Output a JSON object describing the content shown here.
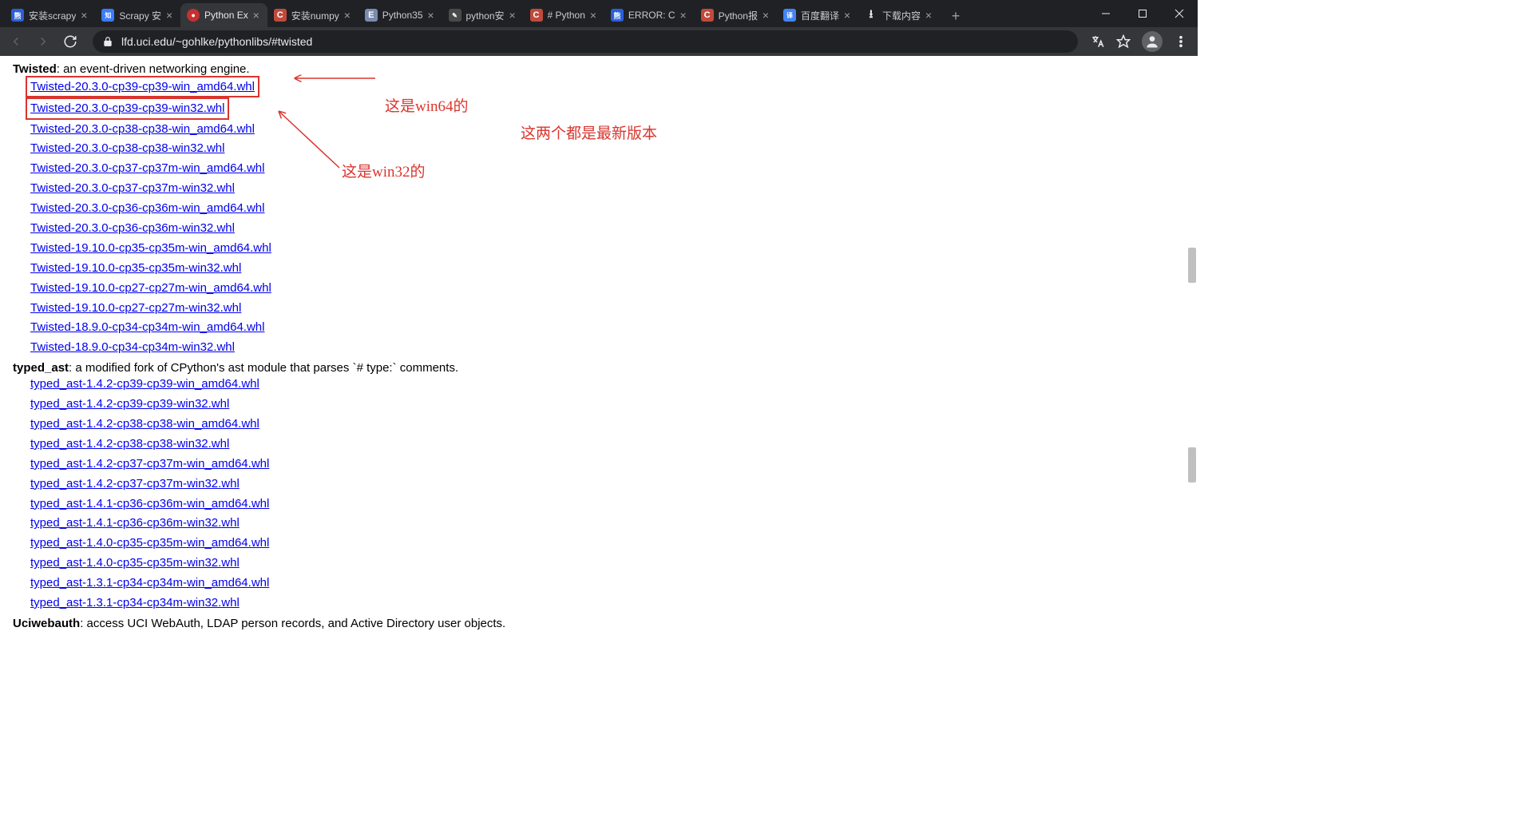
{
  "tabs": [
    {
      "title": "安装scrapy",
      "fav": "baidu"
    },
    {
      "title": "Scrapy 安",
      "fav": "zf"
    },
    {
      "title": "Python Ex",
      "fav": "py",
      "active": true
    },
    {
      "title": "安装numpy",
      "fav": "c"
    },
    {
      "title": "Python35",
      "fav": "e"
    },
    {
      "title": "python安",
      "fav": "cn"
    },
    {
      "title": "# Python",
      "fav": "c"
    },
    {
      "title": "ERROR: C",
      "fav": "baidu"
    },
    {
      "title": "Python报",
      "fav": "c"
    },
    {
      "title": "百度翻译",
      "fav": "tr"
    },
    {
      "title": "下载内容",
      "fav": "dl"
    }
  ],
  "url": "lfd.uci.edu/~gohlke/pythonlibs/#twisted",
  "annotations": {
    "win64": "这是win64的",
    "win32": "这是win32的",
    "both_latest": "这两个都是最新版本"
  },
  "packages": [
    {
      "name": "Twisted",
      "desc": ": an event-driven networking engine.",
      "files": [
        "Twisted-20.3.0-cp39-cp39-win_amd64.whl",
        "Twisted-20.3.0-cp39-cp39-win32.whl",
        "Twisted-20.3.0-cp38-cp38-win_amd64.whl",
        "Twisted-20.3.0-cp38-cp38-win32.whl",
        "Twisted-20.3.0-cp37-cp37m-win_amd64.whl",
        "Twisted-20.3.0-cp37-cp37m-win32.whl",
        "Twisted-20.3.0-cp36-cp36m-win_amd64.whl",
        "Twisted-20.3.0-cp36-cp36m-win32.whl",
        "Twisted-19.10.0-cp35-cp35m-win_amd64.whl",
        "Twisted-19.10.0-cp35-cp35m-win32.whl",
        "Twisted-19.10.0-cp27-cp27m-win_amd64.whl",
        "Twisted-19.10.0-cp27-cp27m-win32.whl",
        "Twisted-18.9.0-cp34-cp34m-win_amd64.whl",
        "Twisted-18.9.0-cp34-cp34m-win32.whl"
      ]
    },
    {
      "name": "typed_ast",
      "desc": ": a modified fork of CPython's ast module that parses `# type:` comments.",
      "files": [
        "typed_ast-1.4.2-cp39-cp39-win_amd64.whl",
        "typed_ast-1.4.2-cp39-cp39-win32.whl",
        "typed_ast-1.4.2-cp38-cp38-win_amd64.whl",
        "typed_ast-1.4.2-cp38-cp38-win32.whl",
        "typed_ast-1.4.2-cp37-cp37m-win_amd64.whl",
        "typed_ast-1.4.2-cp37-cp37m-win32.whl",
        "typed_ast-1.4.1-cp36-cp36m-win_amd64.whl",
        "typed_ast-1.4.1-cp36-cp36m-win32.whl",
        "typed_ast-1.4.0-cp35-cp35m-win_amd64.whl",
        "typed_ast-1.4.0-cp35-cp35m-win32.whl",
        "typed_ast-1.3.1-cp34-cp34m-win_amd64.whl",
        "typed_ast-1.3.1-cp34-cp34m-win32.whl"
      ]
    },
    {
      "name": "Uciwebauth",
      "desc": ": access UCI WebAuth, LDAP person records, and Active Directory user objects.",
      "files": []
    }
  ]
}
